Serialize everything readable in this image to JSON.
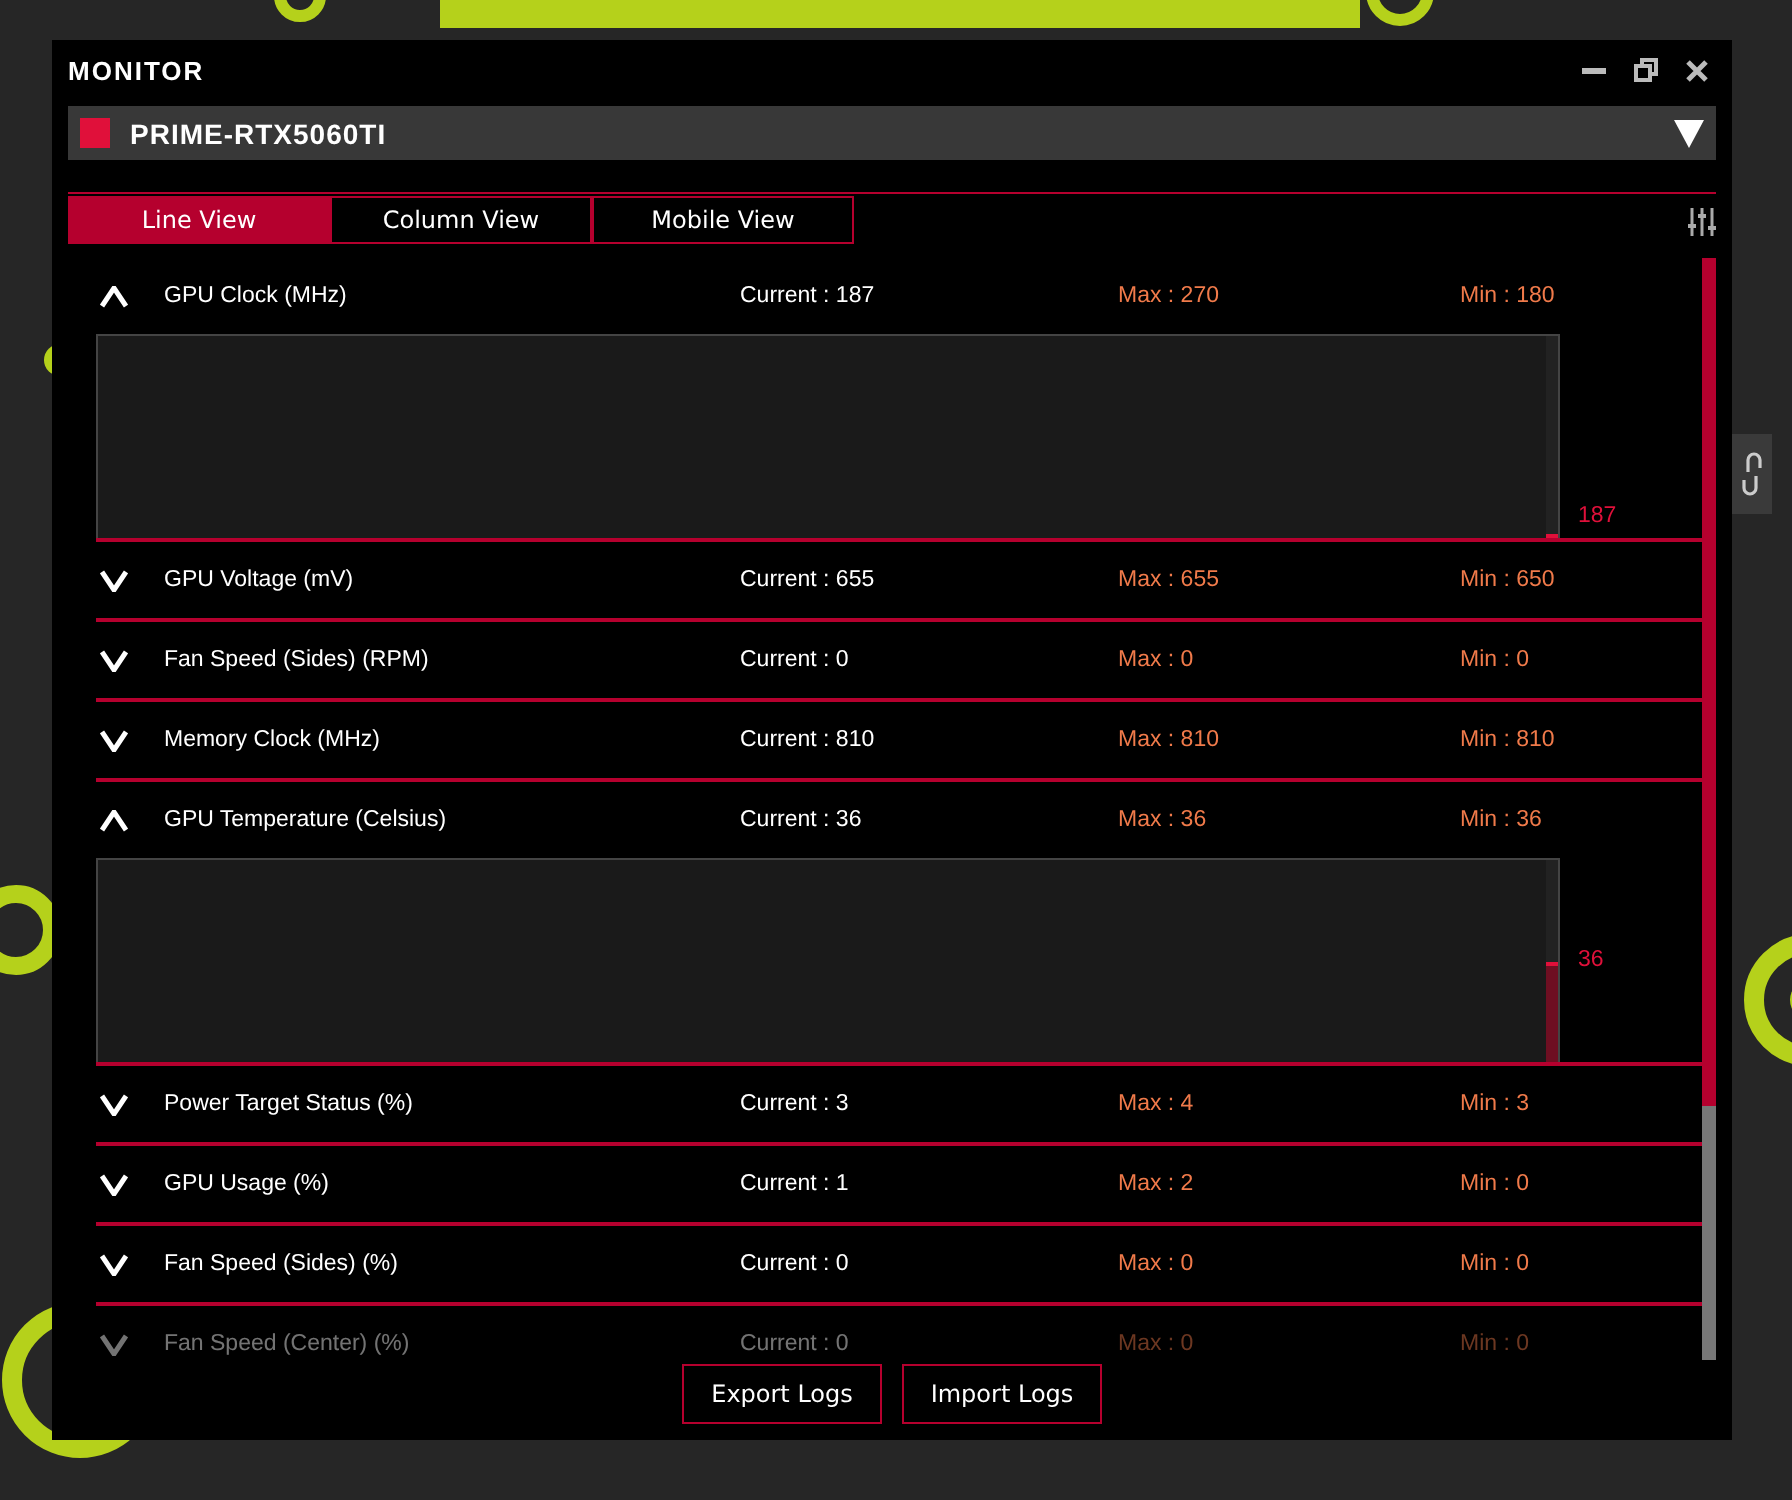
{
  "window": {
    "title": "MONITOR"
  },
  "device": {
    "name": "PRIME-RTX5060TI",
    "color": "#e0103a"
  },
  "tabs": [
    {
      "label": "Line View",
      "selected": true
    },
    {
      "label": "Column View",
      "selected": false
    },
    {
      "label": "Mobile View",
      "selected": false
    }
  ],
  "metrics": [
    {
      "name": "GPU Clock (MHz)",
      "expanded": true,
      "current": "Current : 187",
      "max": "Max : 270",
      "min": "Min : 180",
      "chart_label": "187",
      "level": 0.02
    },
    {
      "name": "GPU Voltage (mV)",
      "expanded": false,
      "current": "Current : 655",
      "max": "Max : 655",
      "min": "Min : 650"
    },
    {
      "name": "Fan Speed (Sides) (RPM)",
      "expanded": false,
      "current": "Current : 0",
      "max": "Max : 0",
      "min": "Min : 0"
    },
    {
      "name": "Memory Clock (MHz)",
      "expanded": false,
      "current": "Current : 810",
      "max": "Max : 810",
      "min": "Min : 810"
    },
    {
      "name": "GPU Temperature (Celsius)",
      "expanded": true,
      "current": "Current : 36",
      "max": "Max : 36",
      "min": "Min : 36",
      "chart_label": "36",
      "level": 0.5
    },
    {
      "name": "Power Target Status (%)",
      "expanded": false,
      "current": "Current : 3",
      "max": "Max : 4",
      "min": "Min : 3"
    },
    {
      "name": "GPU Usage (%)",
      "expanded": false,
      "current": "Current : 1",
      "max": "Max : 2",
      "min": "Min : 0"
    },
    {
      "name": "Fan Speed (Sides) (%)",
      "expanded": false,
      "current": "Current : 0",
      "max": "Max : 0",
      "min": "Min : 0"
    },
    {
      "name": "Fan Speed (Center) (%)",
      "expanded": false,
      "current": "Current : 0",
      "max": "Max : 0",
      "min": "Min : 0"
    }
  ],
  "buttons": [
    "Export Logs",
    "Import Logs"
  ]
}
